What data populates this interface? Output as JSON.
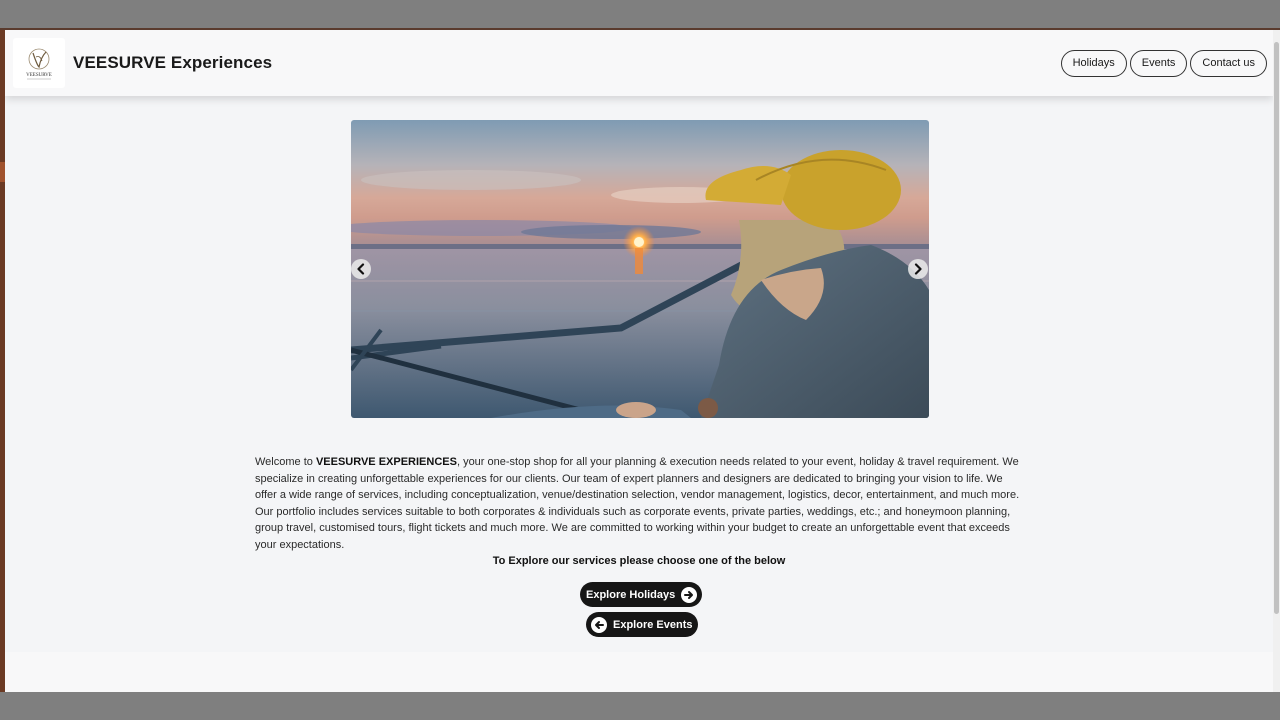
{
  "header": {
    "brand": "VEESURVE Experiences",
    "logo_text": "VEESURVE",
    "nav": [
      "Holidays",
      "Events",
      "Contact us"
    ]
  },
  "carousel": {
    "prev_icon": "chevron-left-icon",
    "next_icon": "chevron-right-icon"
  },
  "intro": {
    "welcome": "Welcome to ",
    "company": "VEESURVE EXPERIENCES",
    "body": ", your one-stop shop for all your planning & execution needs related to your event, holiday & travel requirement. We specialize in creating unforgettable experiences for our clients. Our team of expert planners and designers are dedicated to bringing your vision to life. We offer a wide range of services, including conceptualization, venue/destination selection, vendor management, logistics, decor, entertainment, and much more. Our portfolio includes services suitable to both corporates & individuals such as corporate events, private parties, weddings, etc.; and honeymoon planning, group travel, customised tours, flight tickets and much more. We are committed to working within your budget to create an unforgettable event that exceeds your expectations."
  },
  "cta": {
    "heading": "To Explore our services please choose one of the below",
    "holidays": "Explore Holidays",
    "events": "Explore Events",
    "holidays_icon": "arrow-right-circle-icon",
    "events_icon": "arrow-left-circle-icon"
  },
  "colors": {
    "page_bg": "#f4f5f7",
    "cta_bg": "#161616",
    "nav_border": "#333333"
  }
}
